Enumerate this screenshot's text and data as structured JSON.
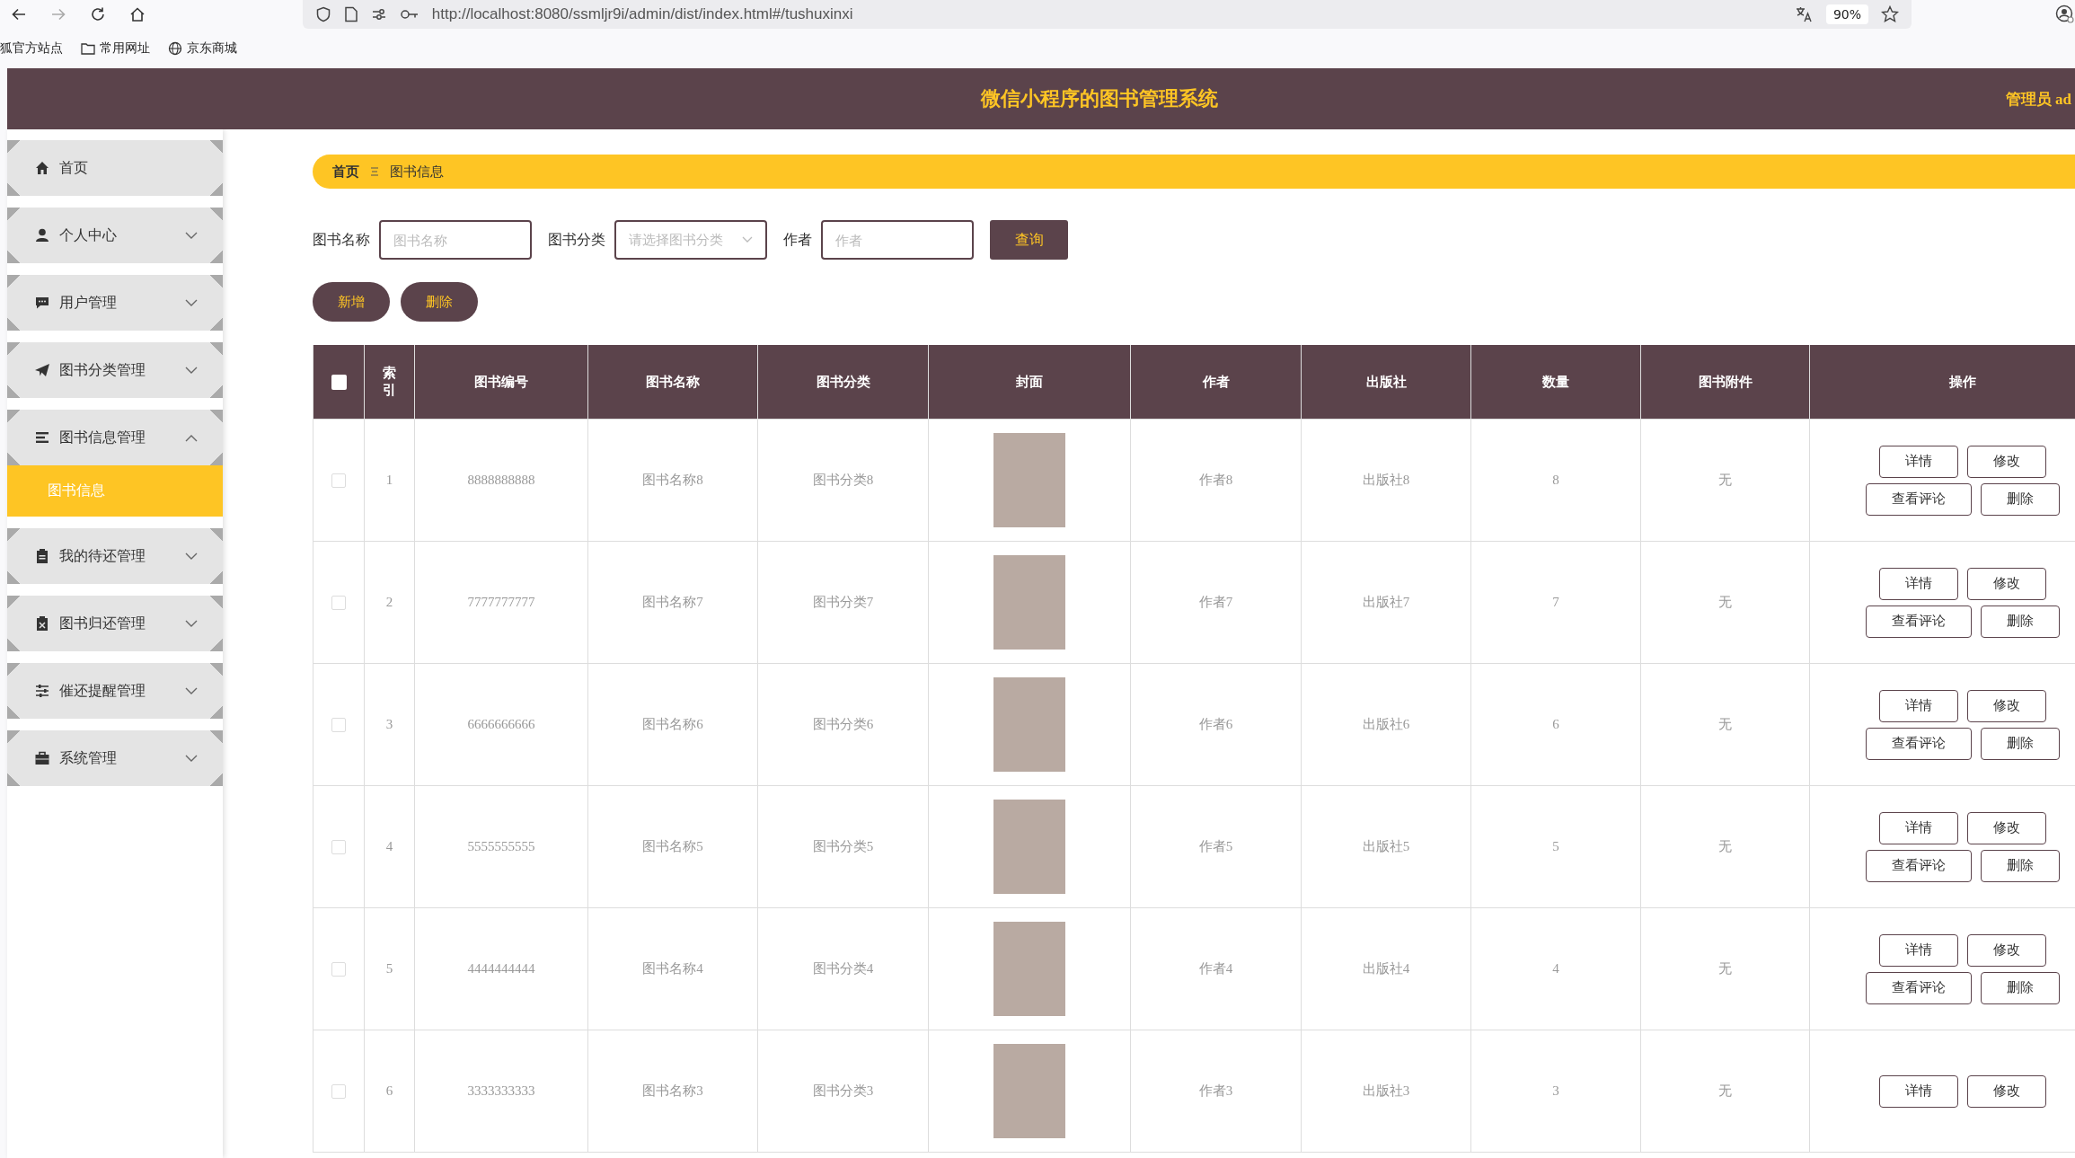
{
  "browser": {
    "url": "http://localhost:8080/ssmljr9i/admin/dist/index.html#/tushuxinxi",
    "zoom": "90%",
    "bookmarks": [
      "狐官方站点",
      "常用网址",
      "京东商城"
    ]
  },
  "header": {
    "title": "微信小程序的图书管理系统",
    "user": "管理员 ad"
  },
  "sidebar": {
    "items": [
      {
        "label": "首页",
        "kind": "link"
      },
      {
        "label": "个人中心",
        "kind": "menu",
        "expanded": false
      },
      {
        "label": "用户管理",
        "kind": "menu",
        "expanded": false
      },
      {
        "label": "图书分类管理",
        "kind": "menu",
        "expanded": false
      },
      {
        "label": "图书信息管理",
        "kind": "menu",
        "expanded": true,
        "children": [
          {
            "label": "图书信息",
            "selected": true
          }
        ]
      },
      {
        "label": "我的待还管理",
        "kind": "menu",
        "expanded": false
      },
      {
        "label": "图书归还管理",
        "kind": "menu",
        "expanded": false
      },
      {
        "label": "催还提醒管理",
        "kind": "menu",
        "expanded": false
      },
      {
        "label": "系统管理",
        "kind": "menu",
        "expanded": false
      }
    ]
  },
  "breadcrumb": {
    "home": "首页",
    "current": "图书信息"
  },
  "filters": [
    {
      "label": "图书名称",
      "kind": "input",
      "placeholder": "图书名称"
    },
    {
      "label": "图书分类",
      "kind": "select",
      "placeholder": "请选择图书分类"
    },
    {
      "label": "作者",
      "kind": "input",
      "placeholder": "作者"
    }
  ],
  "search_button": "查询",
  "actions": [
    "新增",
    "删除"
  ],
  "table": {
    "select_all_checked": false,
    "columns": [
      "索引",
      "图书编号",
      "图书名称",
      "图书分类",
      "封面",
      "作者",
      "出版社",
      "数量",
      "图书附件",
      "操作"
    ],
    "rows": [
      {
        "checked": false,
        "index": "1",
        "code": "8888888888",
        "name": "图书名称8",
        "category": "图书分类8",
        "author": "作者8",
        "publisher": "出版社8",
        "quantity": "8",
        "attachment": "无",
        "buttons": [
          "详情",
          "修改",
          "查看评论",
          "删除"
        ]
      },
      {
        "checked": false,
        "index": "2",
        "code": "7777777777",
        "name": "图书名称7",
        "category": "图书分类7",
        "author": "作者7",
        "publisher": "出版社7",
        "quantity": "7",
        "attachment": "无",
        "buttons": [
          "详情",
          "修改",
          "查看评论",
          "删除"
        ]
      },
      {
        "checked": false,
        "index": "3",
        "code": "6666666666",
        "name": "图书名称6",
        "category": "图书分类6",
        "author": "作者6",
        "publisher": "出版社6",
        "quantity": "6",
        "attachment": "无",
        "buttons": [
          "详情",
          "修改",
          "查看评论",
          "删除"
        ]
      },
      {
        "checked": false,
        "index": "4",
        "code": "5555555555",
        "name": "图书名称5",
        "category": "图书分类5",
        "author": "作者5",
        "publisher": "出版社5",
        "quantity": "5",
        "attachment": "无",
        "buttons": [
          "详情",
          "修改",
          "查看评论",
          "删除"
        ]
      },
      {
        "checked": false,
        "index": "5",
        "code": "4444444444",
        "name": "图书名称4",
        "category": "图书分类4",
        "author": "作者4",
        "publisher": "出版社4",
        "quantity": "4",
        "attachment": "无",
        "buttons": [
          "详情",
          "修改",
          "查看评论",
          "删除"
        ]
      },
      {
        "checked": false,
        "index": "6",
        "code": "3333333333",
        "name": "图书名称3",
        "category": "图书分类3",
        "author": "作者3",
        "publisher": "出版社3",
        "quantity": "3",
        "attachment": "无",
        "buttons": [
          "详情",
          "修改"
        ]
      }
    ]
  }
}
